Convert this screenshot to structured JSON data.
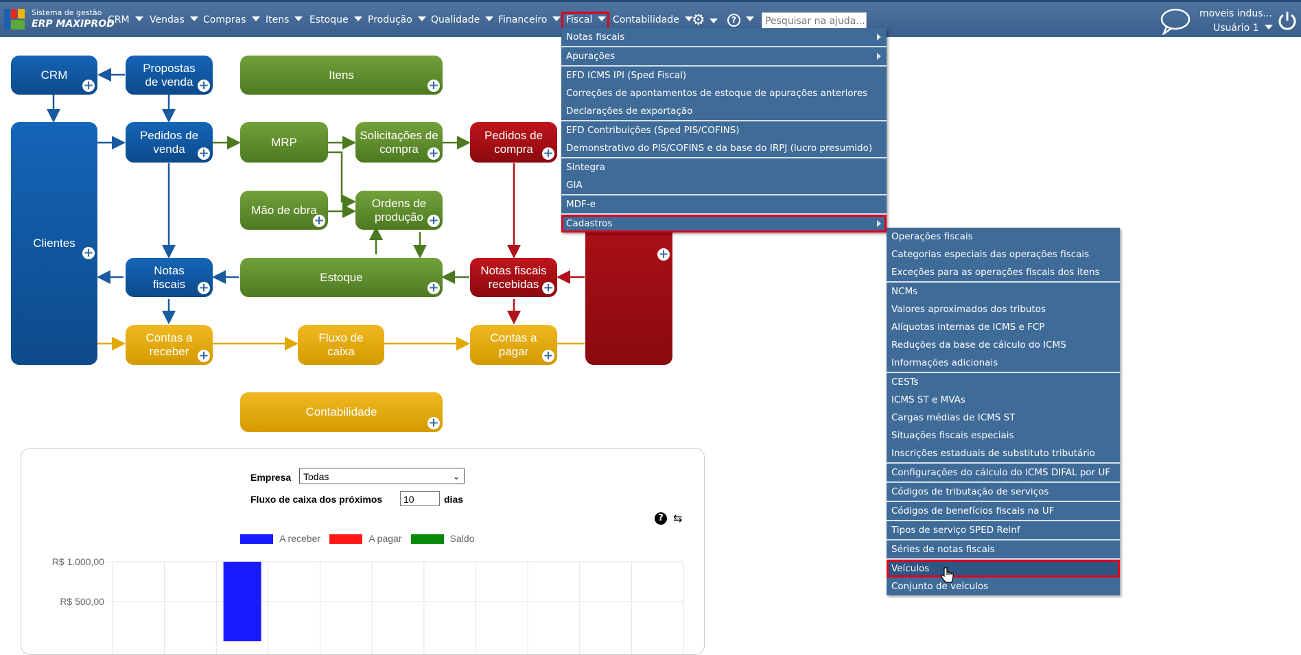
{
  "brand": {
    "line1": "Sistema de gestão",
    "line2": "ERP MAXIPROD"
  },
  "menubar": {
    "items": [
      {
        "label": "CRM"
      },
      {
        "label": "Vendas"
      },
      {
        "label": "Compras"
      },
      {
        "label": "Itens"
      },
      {
        "label": "Estoque"
      },
      {
        "label": "Produção"
      },
      {
        "label": "Qualidade"
      },
      {
        "label": "Financeiro"
      },
      {
        "label": "Fiscal"
      },
      {
        "label": "Contabilidade"
      }
    ],
    "search_placeholder": "Pesquisar na ajuda...",
    "company": "moveis indus...",
    "user": "Usuário 1"
  },
  "flow": {
    "crm": "CRM",
    "propostas": "Propostas de venda",
    "itens": "Itens",
    "clientes": "Clientes",
    "pedidos_venda": "Pedidos de venda",
    "mrp": "MRP",
    "solicitacoes": "Solicitações de compra",
    "pedidos_compra": "Pedidos de compra",
    "mao_obra": "Mão de obra",
    "ordens": "Ordens de produção",
    "notas_fiscais": "Notas fiscais",
    "estoque": "Estoque",
    "nf_recebidas": "Notas fiscais recebidas",
    "contas_receber": "Contas a receber",
    "fluxo_caixa": "Fluxo de caixa",
    "contas_pagar": "Contas a pagar",
    "contabilidade": "Contabilidade"
  },
  "fiscal_menu": {
    "items": [
      {
        "label": "Notas fiscais"
      },
      {
        "label": "Apurações"
      },
      {
        "label": "EFD ICMS IPI (Sped Fiscal)"
      },
      {
        "label": "Correções de apontamentos de estoque de apurações anteriores"
      },
      {
        "label": "Declarações de exportação"
      },
      {
        "label": "EFD Contribuições (Sped PIS/COFINS)"
      },
      {
        "label": "Demonstrativo do PIS/COFINS e da base do IRPJ (lucro presumido)"
      },
      {
        "label": "Sintegra"
      },
      {
        "label": "GIA"
      },
      {
        "label": "MDF-e"
      },
      {
        "label": "Cadastros"
      }
    ]
  },
  "cadastros_menu": {
    "items": [
      {
        "label": "Operações fiscais"
      },
      {
        "label": "Categorias especiais das operações fiscais"
      },
      {
        "label": "Exceções para as operações fiscais dos itens"
      },
      {
        "label": "NCMs"
      },
      {
        "label": "Valores aproximados dos tributos"
      },
      {
        "label": "Alíquotas internas de ICMS e FCP"
      },
      {
        "label": "Reduções da base de cálculo do ICMS"
      },
      {
        "label": "Informações adicionais"
      },
      {
        "label": "CESTs"
      },
      {
        "label": "ICMS ST e MVAs"
      },
      {
        "label": "Cargas médias de ICMS ST"
      },
      {
        "label": "Situações fiscais especiais"
      },
      {
        "label": "Inscrições estaduais de substituto tributário"
      },
      {
        "label": "Configurações do cálculo do ICMS DIFAL por UF"
      },
      {
        "label": "Códigos de tributação de serviços"
      },
      {
        "label": "Códigos de benefícios fiscais na UF"
      },
      {
        "label": "Tipos de serviço SPED Reinf"
      },
      {
        "label": "Séries de notas fiscais"
      },
      {
        "label": "Veículos"
      },
      {
        "label": "Conjunto de veículos"
      }
    ]
  },
  "cashflow": {
    "empresa_label": "Empresa",
    "empresa_value": "Todas",
    "fluxo_label": "Fluxo de caixa dos próximos",
    "fluxo_value": "10",
    "dias_label": "dias",
    "legend": [
      {
        "name": "A receber",
        "color": "#1a1aff"
      },
      {
        "name": "A pagar",
        "color": "#ff1a1a"
      },
      {
        "name": "Saldo",
        "color": "#0a8a0a"
      }
    ]
  },
  "chart_data": {
    "type": "bar",
    "series": [
      {
        "name": "A receber",
        "values": [
          0,
          0,
          1000,
          0,
          0,
          0,
          0,
          0,
          0,
          0,
          0
        ]
      }
    ],
    "yticks": [
      "R$ 1.000,00",
      "R$ 500,00"
    ],
    "ylim": [
      0,
      1000
    ]
  },
  "colors": {
    "highlight": "#e0001a",
    "menu_bg": "#3f6b98",
    "topbar": "#3a5f8c"
  }
}
